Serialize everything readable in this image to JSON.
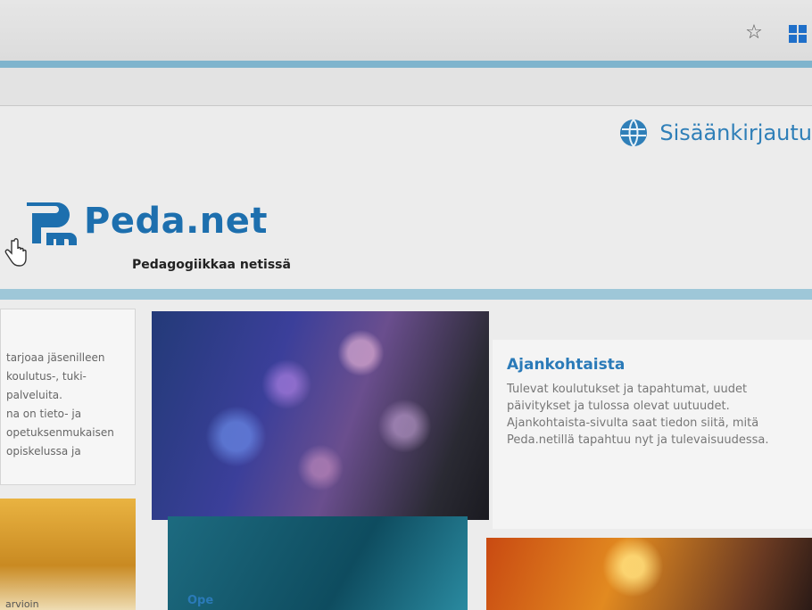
{
  "browser": {
    "star_icon": "bookmark-star-icon",
    "windows_icon": "windows-icon"
  },
  "header": {
    "login_label": "Sisäänkirjautu",
    "logo_text": "Peda.net",
    "tagline": "Pedagogiikkaa netissä"
  },
  "left_card": {
    "lines": [
      "tarjoaa jäsenilleen",
      "koulutus-, tuki-",
      "palveluita.",
      "na on tieto- ja",
      "opetuksenmukaisen",
      "opiskelussa ja"
    ]
  },
  "news": {
    "title": "Ajankohtaista",
    "body": "Tulevat koulutukset ja tapahtumat, uudet päivitykset ja tulossa olevat uutuudet. Ajankohtaista-sivulta saat tiedon siitä, mitä Peda.netillä tapahtuu nyt ja tulevaisuudessa."
  },
  "bottom": {
    "left_label": "arvioin",
    "mid_label": "Ope"
  },
  "colors": {
    "brand_blue": "#1d6fae",
    "link_blue": "#2a7ab8",
    "band_blue": "#9ec7d8"
  }
}
